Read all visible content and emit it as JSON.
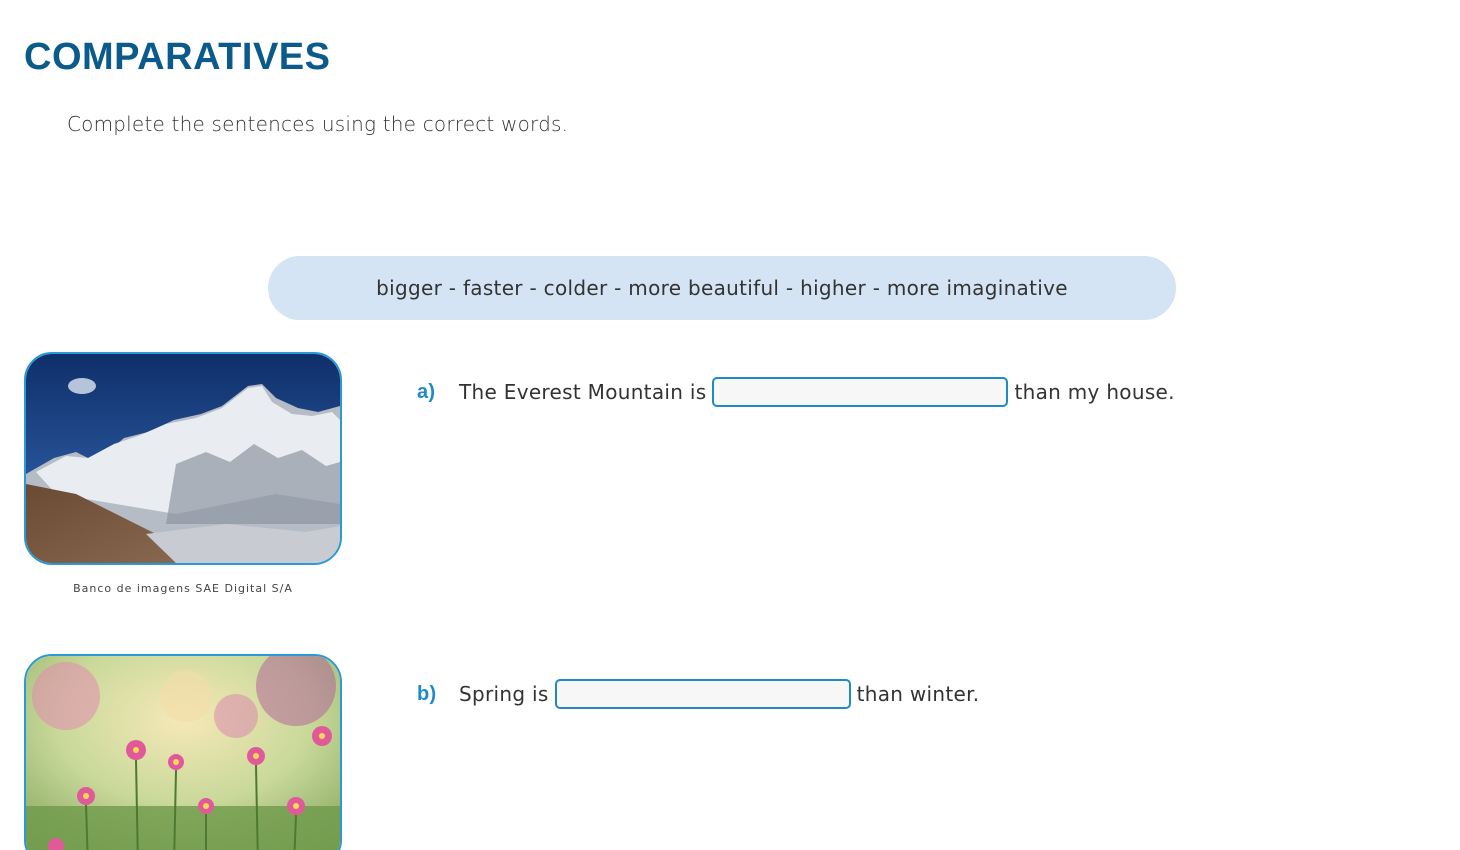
{
  "title": "COMPARATIVES",
  "instructions": "Complete the sentences using the correct words.",
  "word_bank": "bigger - faster - colder - more beautiful - higher - more imaginative",
  "image_credit": "Banco de imagens SAE Digital S/A",
  "questions": [
    {
      "letter": "a)",
      "before": "The Everest Mountain is",
      "after": "than my house.",
      "answer_value": ""
    },
    {
      "letter": "b)",
      "before": "Spring is",
      "after": "than winter.",
      "answer_value": ""
    }
  ],
  "colors": {
    "title": "#0a5b8c",
    "accent": "#1f8acb",
    "word_bank_bg": "#d4e4f4",
    "image_border": "#2a9ad6"
  }
}
